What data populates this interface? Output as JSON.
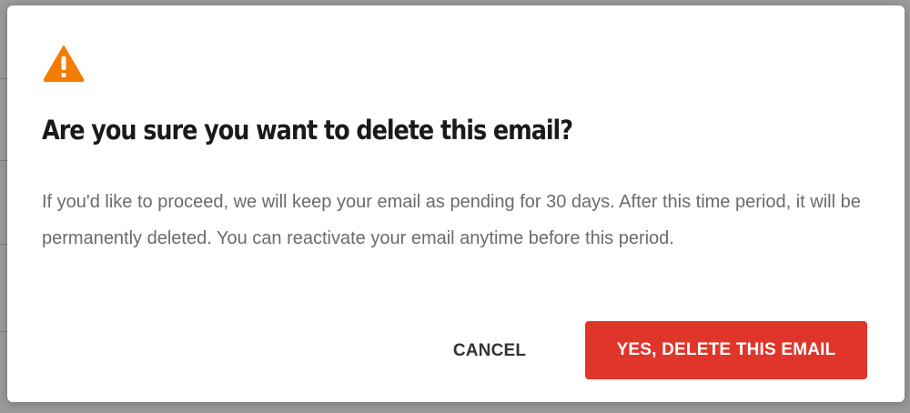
{
  "dialog": {
    "icon": "warning-icon",
    "title": "Are you sure you want to delete this email?",
    "message": "If you'd like to proceed, we will keep your email as pending for 30 days. After this time period, it will be permanently deleted. You can reactivate your email anytime before this period.",
    "cancel_label": "CANCEL",
    "confirm_label": "YES, DELETE THIS EMAIL"
  },
  "colors": {
    "warning": "#f57c00",
    "danger": "#e0352b",
    "overlay": "#8a8a8a"
  }
}
